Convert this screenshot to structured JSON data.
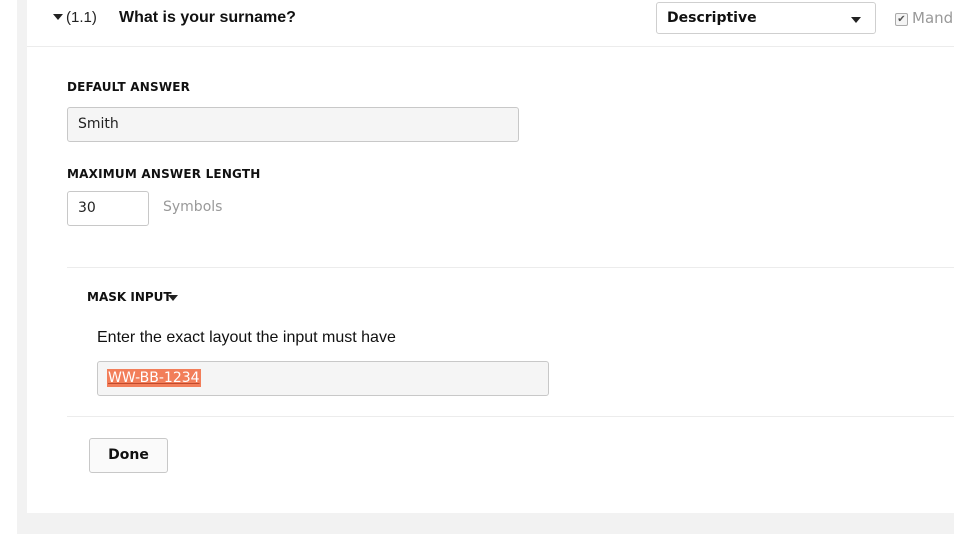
{
  "question": {
    "number": "(1.1)",
    "title": "What is your surname?",
    "type_select": {
      "selected": "Descriptive"
    },
    "mandatory_label": "Mandat"
  },
  "form": {
    "default_answer": {
      "label": "DEFAULT ANSWER",
      "value": "Smith"
    },
    "max_length": {
      "label": "MAXIMUM ANSWER LENGTH",
      "value": "30",
      "unit": "Symbols"
    },
    "mask_input": {
      "title": "MASK INPUT",
      "hint": "Enter the exact layout the input must have",
      "value": "WW-BB-1234"
    },
    "done_label": "Done"
  },
  "icons": {
    "collapse": "chevron-down-icon",
    "select_arrow": "caret-down-icon",
    "mandatory": "checkbox-checked-icon"
  }
}
